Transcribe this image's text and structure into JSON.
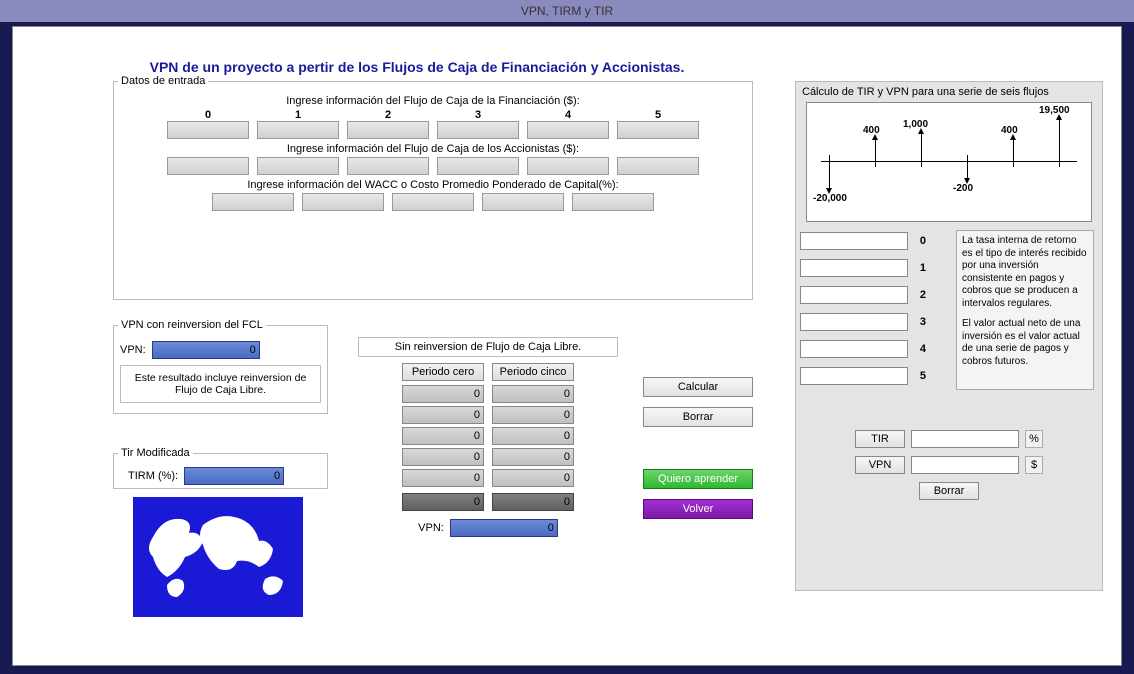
{
  "window": {
    "title": "VPN, TIRM y TIR"
  },
  "main_title": "VPN de un proyecto a pertir de los Flujos de Caja de Financiación y Accionistas.",
  "datos": {
    "legend": "Datos de entrada",
    "prompt_fin": "Ingrese información del Flujo de Caja de la Financiación ($):",
    "prompt_acc": "Ingrese información del Flujo de Caja de los Accionistas ($):",
    "prompt_wacc": "Ingrese información del WACC o Costo Promedio Ponderado de Capital(%):",
    "headers": [
      "0",
      "1",
      "2",
      "3",
      "4",
      "5"
    ],
    "fin": [
      "",
      "",
      "",
      "",
      "",
      ""
    ],
    "acc": [
      "",
      "",
      "",
      "",
      "",
      ""
    ],
    "wacc": [
      "",
      "",
      "",
      "",
      ""
    ]
  },
  "vpn_reinv": {
    "legend": "VPN con reinversion del FCL",
    "label": "VPN:",
    "value": "0",
    "note": "Este resultado incluye reinversion de Flujo de Caja Libre."
  },
  "tirm": {
    "legend": "Tir Modificada",
    "label": "TIRM (%):",
    "value": "0"
  },
  "sin_reinv": {
    "title": "Sin reinversion de Flujo de Caja Libre.",
    "btn_zero": "Periodo cero",
    "btn_five": "Periodo cinco",
    "rows": [
      [
        "0",
        "0"
      ],
      [
        "0",
        "0"
      ],
      [
        "0",
        "0"
      ],
      [
        "0",
        "0"
      ],
      [
        "0",
        "0"
      ]
    ],
    "sum": [
      "0",
      "0"
    ],
    "vpn_label": "VPN:",
    "vpn_value": "0"
  },
  "actions": {
    "calc": "Calcular",
    "clear": "Borrar",
    "learn": "Quiero aprender",
    "back": "Volver"
  },
  "right": {
    "title": "Cálculo de TIR y VPN para una serie de seis flujos",
    "diagram": {
      "values": [
        "-20,000",
        "400",
        "1,000",
        "-200",
        "400",
        "19,500"
      ]
    },
    "flows": [
      "",
      "",
      "",
      "",
      "",
      ""
    ],
    "flow_labels": [
      "0",
      "1",
      "2",
      "3",
      "4",
      "5"
    ],
    "desc1": "La tasa interna de retorno es el tipo de interés recibido por una inversión consistente en pagos y cobros que se producen a intervalos regulares.",
    "desc2": "El valor actual neto de una inversión es el valor actual de una serie de pagos y cobros futuros.",
    "tir_btn": "TIR",
    "vpn_btn": "VPN",
    "clear_btn": "Borrar",
    "tir_val": "",
    "vpn_val": "",
    "pct": "%",
    "dollar": "$"
  }
}
